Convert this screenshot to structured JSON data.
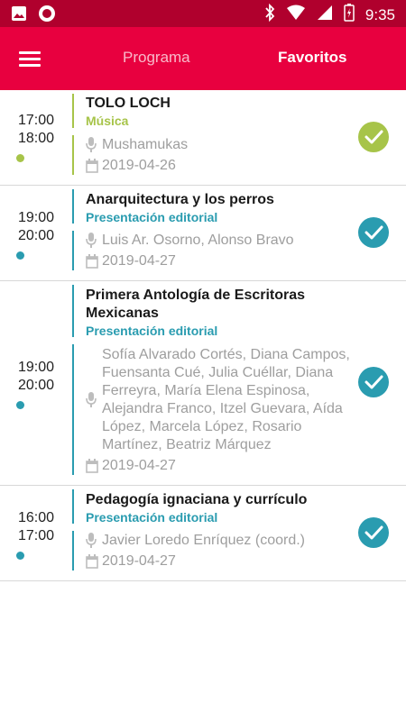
{
  "statusbar": {
    "time": "9:35"
  },
  "appbar": {
    "tabs": [
      {
        "label": "Programa"
      },
      {
        "label": "Favoritos"
      }
    ]
  },
  "colors": {
    "primary": "#e8003f",
    "music": "#a7c449",
    "editorial": "#2a9cb0"
  },
  "events": [
    {
      "start": "17:00",
      "end": "18:00",
      "title": "TOLO LOCH",
      "category": "Música",
      "speakers": "Mushamukas",
      "date": "2019-04-26"
    },
    {
      "start": "19:00",
      "end": "20:00",
      "title": "Anarquitectura y los perros",
      "category": "Presentación editorial",
      "speakers": "Luis Ar. Osorno, Alonso Bravo",
      "date": "2019-04-27"
    },
    {
      "start": "19:00",
      "end": "20:00",
      "title": "Primera Antología de Escritoras Mexicanas",
      "category": "Presentación editorial",
      "speakers": "Sofía Alvarado Cortés, Diana Campos, Fuensanta Cué, Julia Cuéllar, Diana Ferreyra, María Elena Espinosa, Alejandra Franco, Itzel Guevara, Aída López, Marcela López, Rosario Martínez, Beatriz Márquez",
      "date": "2019-04-27"
    },
    {
      "start": "16:00",
      "end": "17:00",
      "title": "Pedagogía ignaciana y currículo",
      "category": "Presentación editorial",
      "speakers": "Javier Loredo Enríquez (coord.)",
      "date": "2019-04-27"
    }
  ]
}
